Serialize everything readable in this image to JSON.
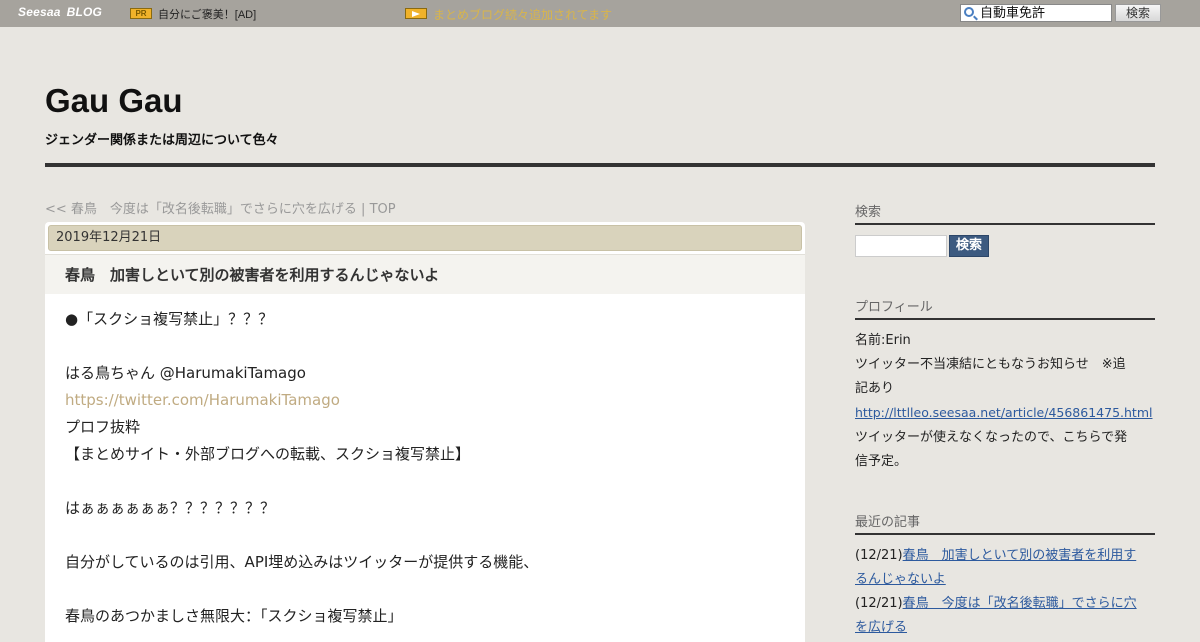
{
  "topbar": {
    "logo": "Seesaa",
    "logo_blog": "BLOG",
    "pr_badge": "PR",
    "ad_text": "自分にご褒美！[AD]",
    "news_text": "まとめブログ続々追加されてます",
    "search_value": "自動車免許",
    "search_button": "検索"
  },
  "header": {
    "title": "Gau Gau",
    "description": "ジェンダー関係または周辺について色々"
  },
  "nav": {
    "prev": "<< 春鳥　今度は「改名後転職」でさらに穴を広げる",
    "separator": " | ",
    "top": "TOP"
  },
  "article": {
    "date": "2019年12月21日",
    "title": "春鳥　加害しといて別の被害者を利用するんじゃないよ",
    "lines": [
      "●「スクショ複写禁止」？？？",
      "",
      "はる鳥ちゃん  @HarumakiTamago",
      "https://twitter.com/HarumakiTamago",
      "プロフ抜粋",
      "【まとめサイト・外部ブログへの転載、スクショ複写禁止】",
      "",
      "はぁぁぁぁぁぁ？？？？？？？",
      "",
      "自分がしているのは引用、API埋め込みはツイッターが提供する機能、",
      "",
      "春鳥のあつかましさ無限大：「スクショ複写禁止」"
    ],
    "link_line_index": 3
  },
  "sidebar": {
    "search_heading": "検索",
    "search_button": "検索",
    "profile_heading": "プロフィール",
    "profile_name": "名前:Erin",
    "profile_notice_1": "ツイッター不当凍結にともなうお知らせ　※追",
    "profile_notice_2": "記あり",
    "profile_link": "http://lttlleo.seesaa.net/article/456861475.html",
    "profile_after_1": "ツイッターが使えなくなったので、こちらで発",
    "profile_after_2": "信予定。",
    "recent_heading": "最近の記事",
    "recent": [
      {
        "date": "(12/21)",
        "title_1": "春鳥　加害しといて別の被害者を利用す",
        "title_2": "るんじゃないよ"
      },
      {
        "date": "(12/21)",
        "title_1": "春鳥　今度は「改名後転職」でさらに穴",
        "title_2": "を広げる"
      }
    ]
  },
  "colors": {
    "background": "#e8e6e1",
    "topbar": "#a6a39d",
    "date_bar": "#d9d3bc",
    "link_body": "#c0ab82",
    "link_sidebar": "#2d5a9e",
    "search_button": "#3c5a80"
  }
}
